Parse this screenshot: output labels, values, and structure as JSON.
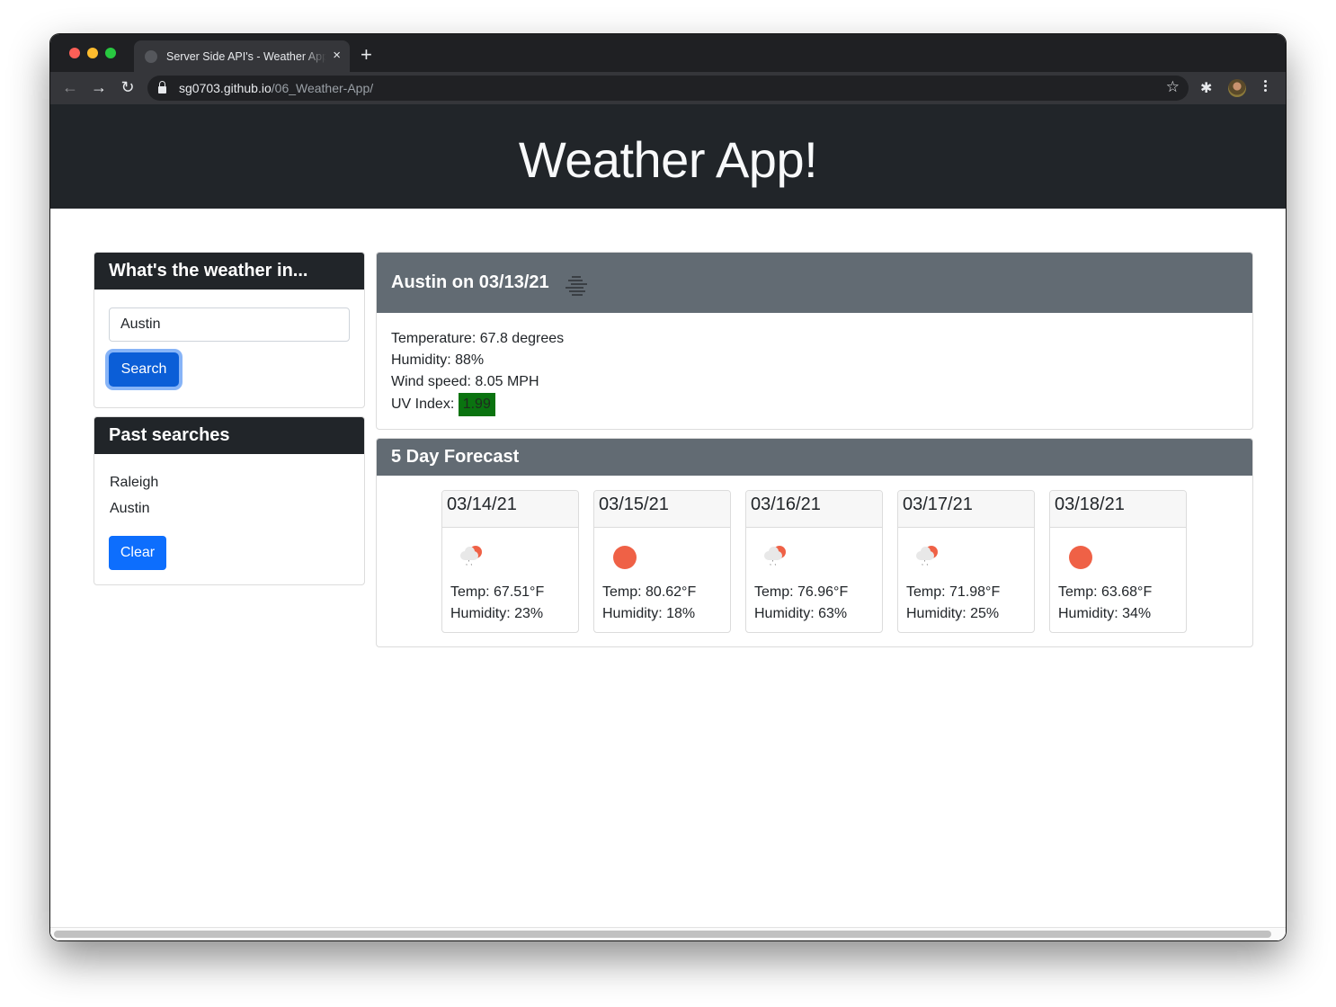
{
  "browser": {
    "tab_title": "Server Side API's - Weather App",
    "tab_close": "×",
    "new_tab": "+",
    "url_host": "sg0703.github.io",
    "url_path": "/06_Weather-App/",
    "icons": {
      "back": "←",
      "forward": "→",
      "reload": "↻",
      "bookmark": "☆",
      "extensions": "✱"
    }
  },
  "page": {
    "title": "Weather App!",
    "search": {
      "heading": "What's the weather in...",
      "input_value": "Austin",
      "button_label": "Search"
    },
    "past": {
      "heading": "Past searches",
      "items": [
        "Raleigh",
        "Austin"
      ],
      "clear_label": "Clear"
    },
    "current": {
      "heading": "Austin on 03/13/21",
      "icon": "haze-icon",
      "temperature": "Temperature: 67.8 degrees",
      "humidity": "Humidity: 88%",
      "wind": "Wind speed: 8.05 MPH",
      "uv_label": "UV Index: ",
      "uv_value": "1.99",
      "uv_color": "#0a7310"
    },
    "forecast": {
      "heading": "5 Day Forecast",
      "days": [
        {
          "date": "03/14/21",
          "icon": "rain-sun",
          "temp": "Temp: 67.51°F",
          "humidity": "Humidity: 23%"
        },
        {
          "date": "03/15/21",
          "icon": "sun",
          "temp": "Temp: 80.62°F",
          "humidity": "Humidity: 18%"
        },
        {
          "date": "03/16/21",
          "icon": "rain-sun",
          "temp": "Temp: 76.96°F",
          "humidity": "Humidity: 63%"
        },
        {
          "date": "03/17/21",
          "icon": "rain-sun",
          "temp": "Temp: 71.98°F",
          "humidity": "Humidity: 25%"
        },
        {
          "date": "03/18/21",
          "icon": "sun",
          "temp": "Temp: 63.68°F",
          "humidity": "Humidity: 34%"
        }
      ]
    }
  }
}
